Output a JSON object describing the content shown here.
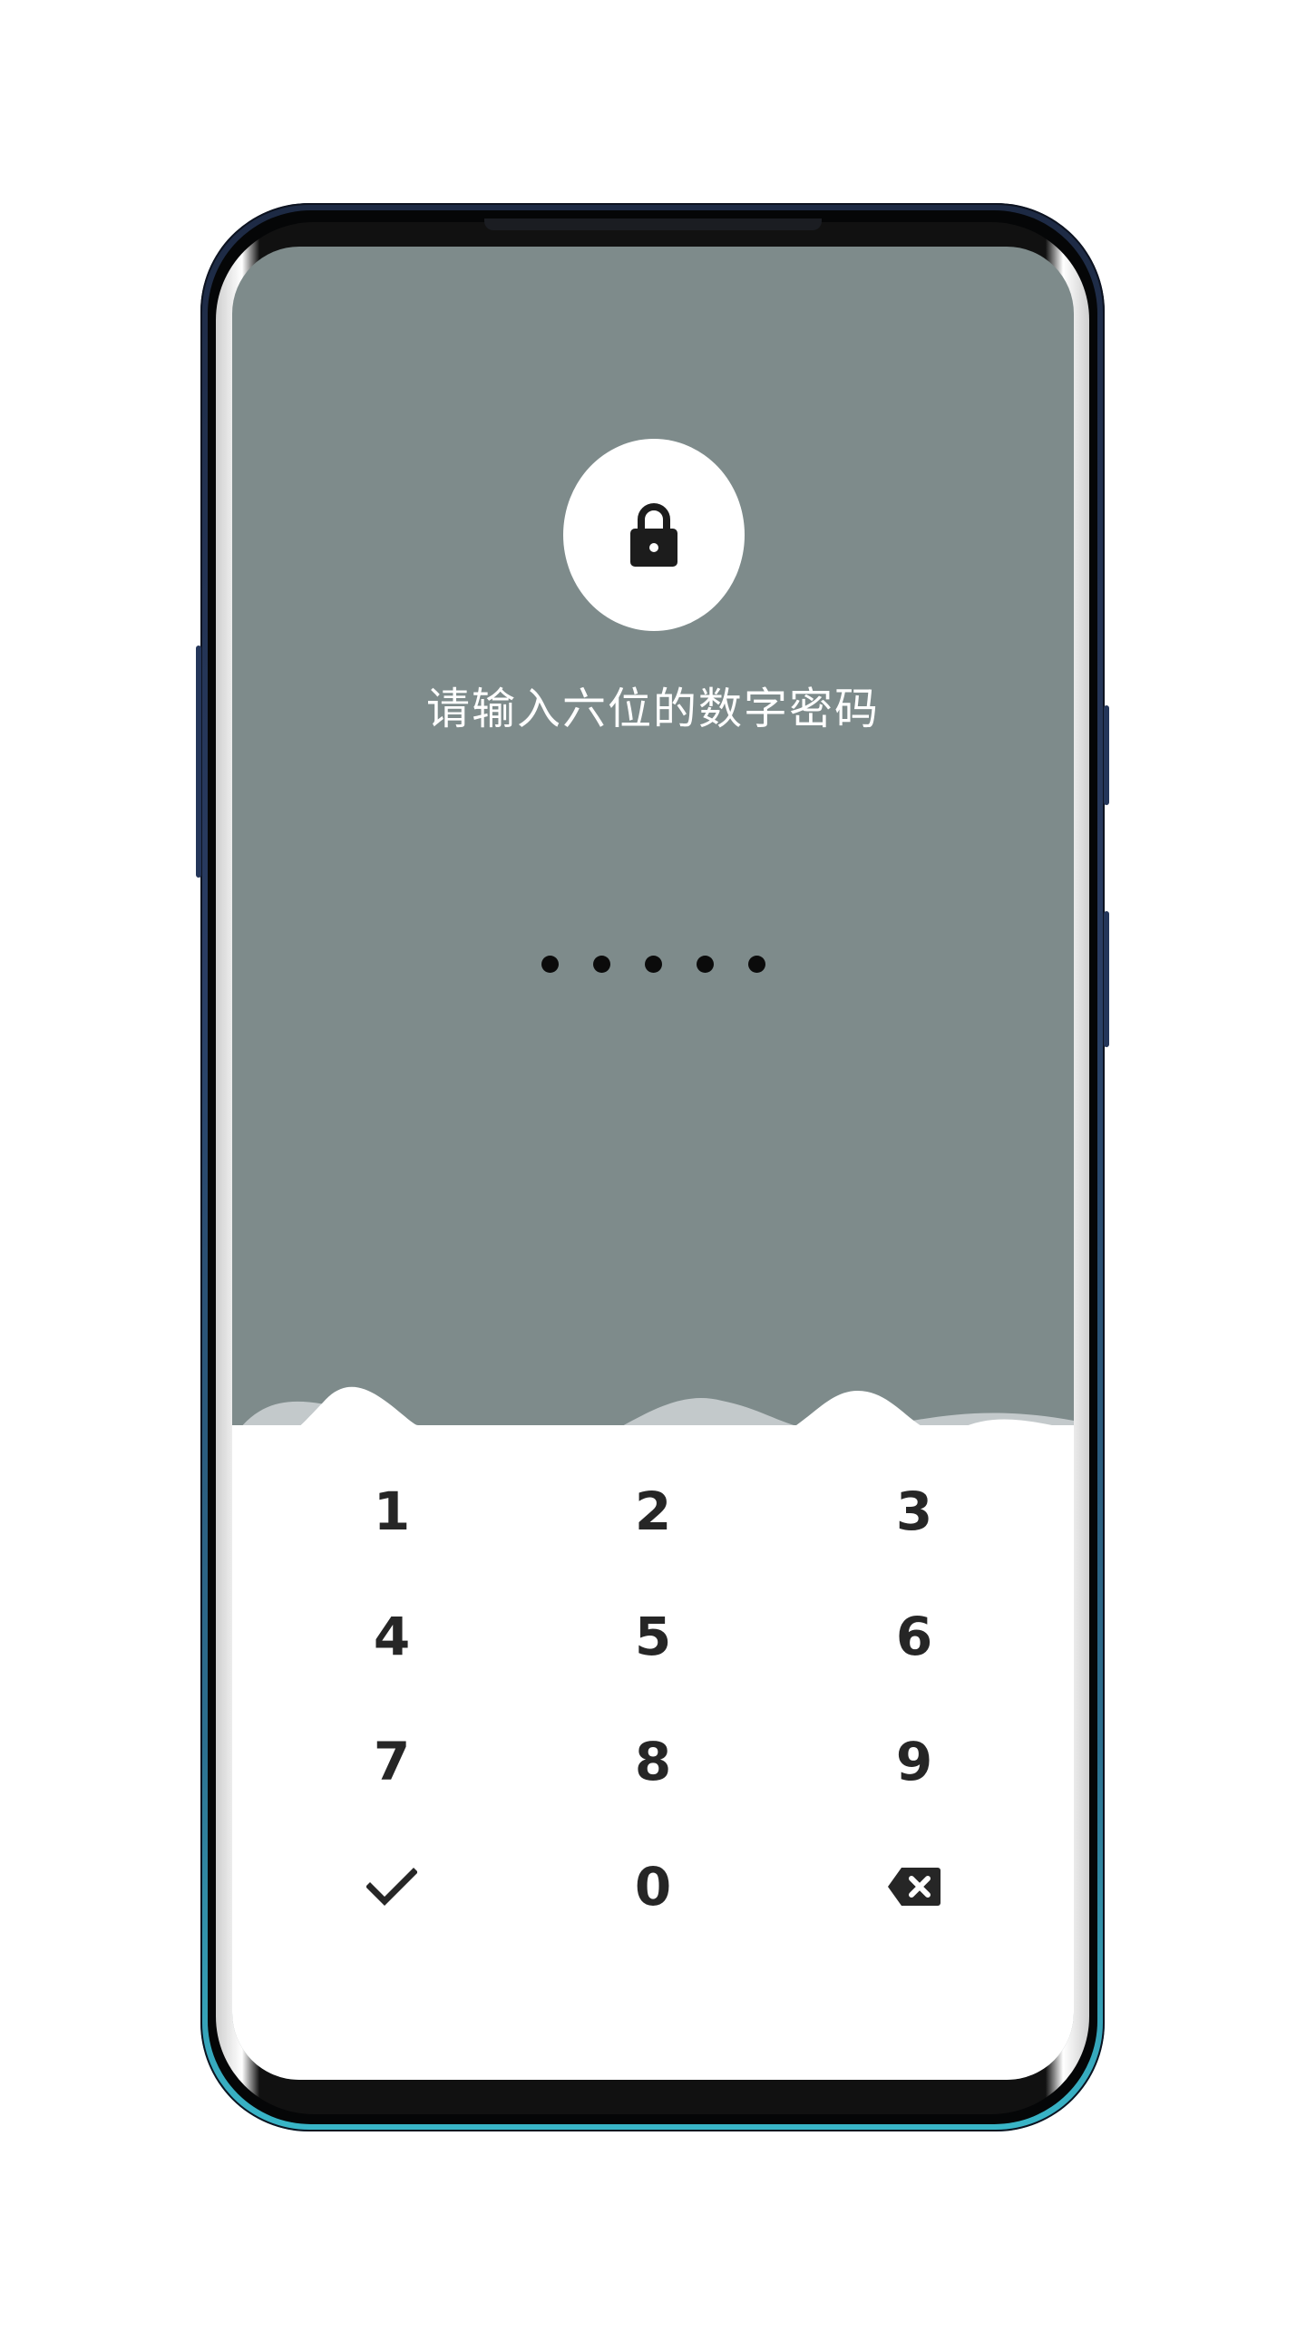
{
  "prompt": "请输入六位的数字密码",
  "pin": {
    "entered_count": 5,
    "length": 6
  },
  "keypad": {
    "row1": [
      "1",
      "2",
      "3"
    ],
    "row2": [
      "4",
      "5",
      "6"
    ],
    "row3": [
      "7",
      "8",
      "9"
    ],
    "row4_center": "0"
  },
  "icons": {
    "lock": "lock-icon",
    "confirm": "checkmark-icon",
    "delete": "backspace-icon"
  },
  "colors": {
    "background_top": "#7e8b8b",
    "keypad_background": "#ffffff",
    "wave_back": "#c3c9cb",
    "key_text": "#262626",
    "pin_dot": "#0b0b0b"
  }
}
